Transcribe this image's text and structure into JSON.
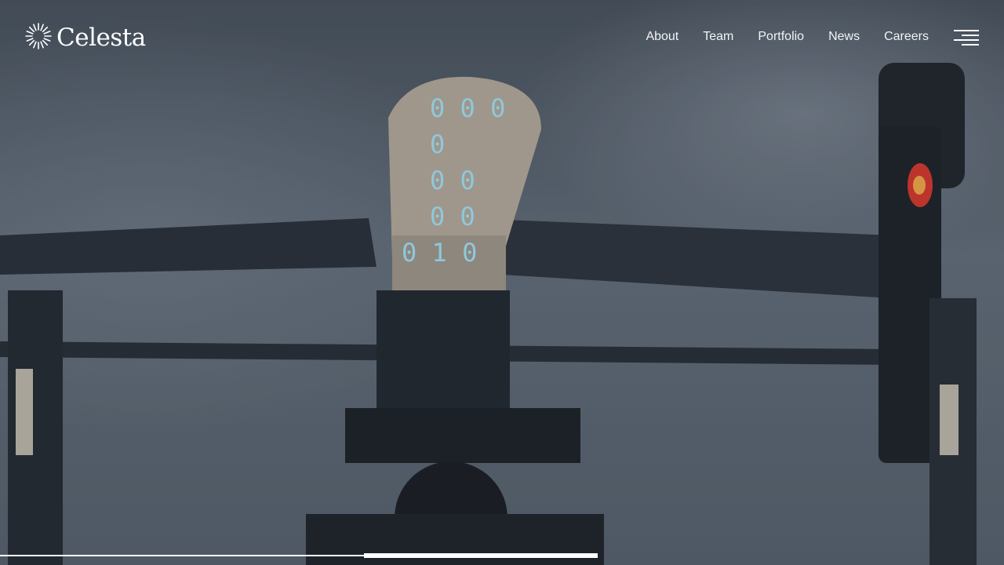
{
  "brand": {
    "name": "Celesta",
    "logo_icon": "sunburst-icon"
  },
  "nav": {
    "items": [
      {
        "label": "About"
      },
      {
        "label": "Team"
      },
      {
        "label": "Portfolio"
      },
      {
        "label": "News"
      },
      {
        "label": "Careers"
      }
    ],
    "menu_icon": "hamburger-menu-icon"
  },
  "hero": {
    "image_subject": "drone-image",
    "display_digits": [
      "0 0 0 0",
      "0 0",
      "0 0",
      "0 1 0"
    ]
  },
  "slider": {
    "progress": 0.6
  },
  "colors": {
    "text": "#ffffff",
    "overlay": "#5f6b78"
  }
}
